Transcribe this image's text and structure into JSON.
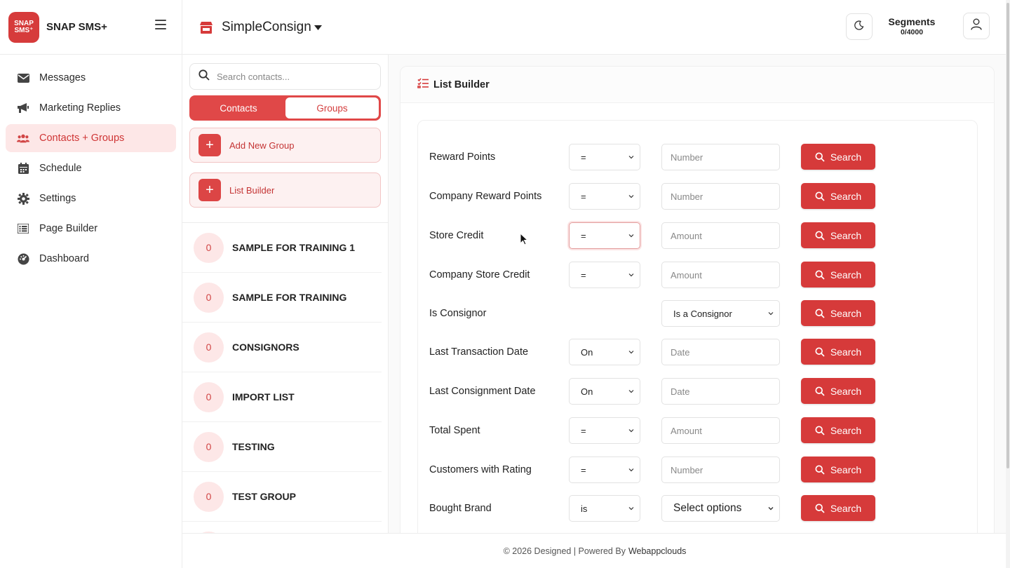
{
  "brand": {
    "logo_line1": "SNAP",
    "logo_line2": "SMS⁺",
    "name": "SNAP SMS+"
  },
  "sidebar": {
    "items": [
      {
        "label": "Messages",
        "icon": "envelope-icon"
      },
      {
        "label": "Marketing Replies",
        "icon": "megaphone-icon"
      },
      {
        "label": "Contacts + Groups",
        "icon": "users-icon",
        "active": true
      },
      {
        "label": "Schedule",
        "icon": "calendar-icon"
      },
      {
        "label": "Settings",
        "icon": "gear-icon"
      },
      {
        "label": "Page Builder",
        "icon": "list-icon"
      },
      {
        "label": "Dashboard",
        "icon": "gauge-icon"
      }
    ]
  },
  "header": {
    "store_name": "SimpleConsign",
    "segments_label": "Segments",
    "segments_value": "0/4000"
  },
  "contacts_panel": {
    "search_placeholder": "Search contacts...",
    "tabs": {
      "contacts": "Contacts",
      "groups": "Groups",
      "active": "Groups"
    },
    "actions": {
      "add_group": "Add New Group",
      "list_builder": "List Builder"
    },
    "groups": [
      {
        "count": "0",
        "name": "SAMPLE FOR TRAINING 1"
      },
      {
        "count": "0",
        "name": "SAMPLE FOR TRAINING"
      },
      {
        "count": "0",
        "name": "CONSIGNORS"
      },
      {
        "count": "0",
        "name": "IMPORT LIST"
      },
      {
        "count": "0",
        "name": "TESTING"
      },
      {
        "count": "0",
        "name": "TEST GROUP"
      }
    ]
  },
  "list_builder": {
    "title": "List Builder",
    "search_label": "Search",
    "rows": [
      {
        "label": "Reward Points",
        "operator": "=",
        "value": "Number"
      },
      {
        "label": "Company Reward Points",
        "operator": "=",
        "value": "Number"
      },
      {
        "label": "Store Credit",
        "operator": "=",
        "value": "Amount"
      },
      {
        "label": "Company Store Credit",
        "operator": "=",
        "value": "Amount"
      },
      {
        "label": "Is Consignor",
        "operator": "",
        "value": "Is a Consignor"
      },
      {
        "label": "Last Transaction Date",
        "operator": "On",
        "value": "Date"
      },
      {
        "label": "Last Consignment Date",
        "operator": "On",
        "value": "Date"
      },
      {
        "label": "Total Spent",
        "operator": "=",
        "value": "Amount"
      },
      {
        "label": "Customers with Rating",
        "operator": "=",
        "value": "Number"
      },
      {
        "label": "Bought Brand",
        "operator": "is",
        "value": "Select options"
      }
    ]
  },
  "footer": {
    "text": "© 2026 Designed | Powered By",
    "link": "Webappclouds"
  },
  "colors": {
    "accent": "#d63a3a",
    "accent_light": "#fde7e7"
  }
}
